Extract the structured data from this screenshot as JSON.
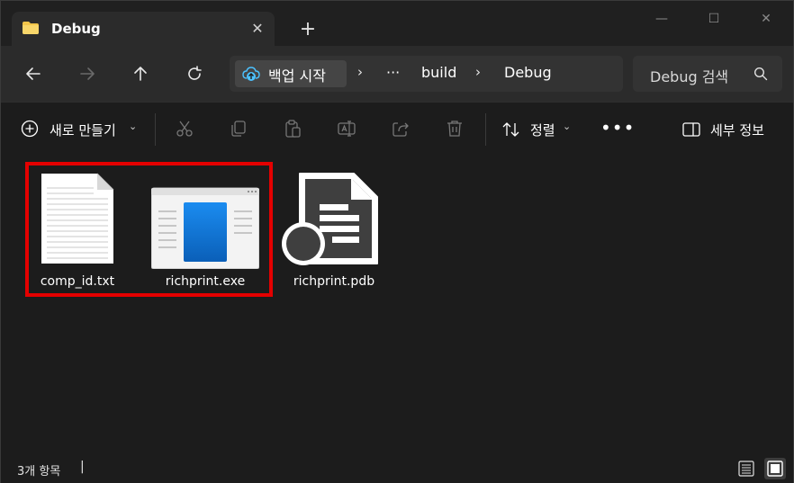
{
  "window": {
    "tab_title": "Debug",
    "new_tab_glyph": "+",
    "close_tab_glyph": "✕",
    "controls": {
      "minimize": "—",
      "maximize": "☐",
      "close": "✕"
    }
  },
  "navigation": {
    "back_icon": "arrow-left-icon",
    "forward_icon": "arrow-right-icon",
    "up_icon": "arrow-up-icon",
    "refresh_icon": "refresh-icon"
  },
  "address": {
    "home_label": "백업 시작",
    "overflow": "···",
    "crumbs": [
      "build",
      "Debug"
    ],
    "separator": "›"
  },
  "search": {
    "placeholder": "Debug 검색"
  },
  "commands": {
    "new_label": "새로 만들기",
    "sort_label": "정렬",
    "more": "•••",
    "details_label": "세부 정보",
    "chevron": "⌄"
  },
  "files": [
    {
      "name": "comp_id.txt",
      "icon": "text-file-icon"
    },
    {
      "name": "richprint.exe",
      "icon": "application-icon"
    },
    {
      "name": "richprint.pdb",
      "icon": "pdb-file-icon"
    }
  ],
  "status": {
    "item_count": "3개 항목",
    "cursor": "|"
  },
  "colors": {
    "accent": "#0078d4",
    "highlight_border": "#e40000",
    "background": "#1c1c1c"
  }
}
